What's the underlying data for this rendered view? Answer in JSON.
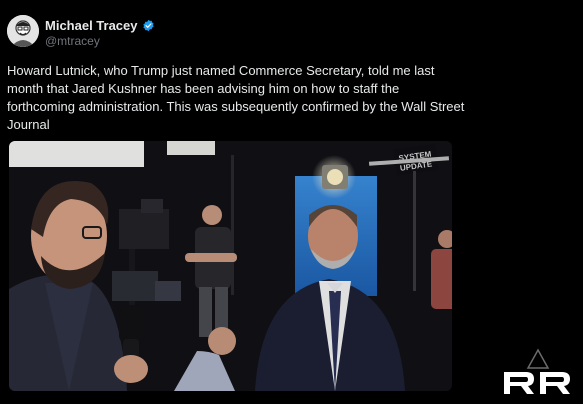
{
  "author": {
    "display_name": "Michael Tracey",
    "handle": "@mtracey",
    "avatar_icon": "avatar-sketch",
    "verified": true,
    "verified_color": "#1d9bf0"
  },
  "tweet": {
    "text": "Howard Lutnick, who Trump just named Commerce Secretary, told me last month that Jared Kushner has been advising him on how to staff the forthcoming administration. This was subsequently confirmed by the Wall Street Journal"
  },
  "media": {
    "type": "video",
    "studio_sign_line1": "SYSTEM",
    "studio_sign_line2": "UPDATE"
  },
  "watermark": {
    "icon": "rr-logo"
  },
  "colors": {
    "background": "#000000",
    "text_primary": "#e7e9ea",
    "text_secondary": "#71767b"
  }
}
